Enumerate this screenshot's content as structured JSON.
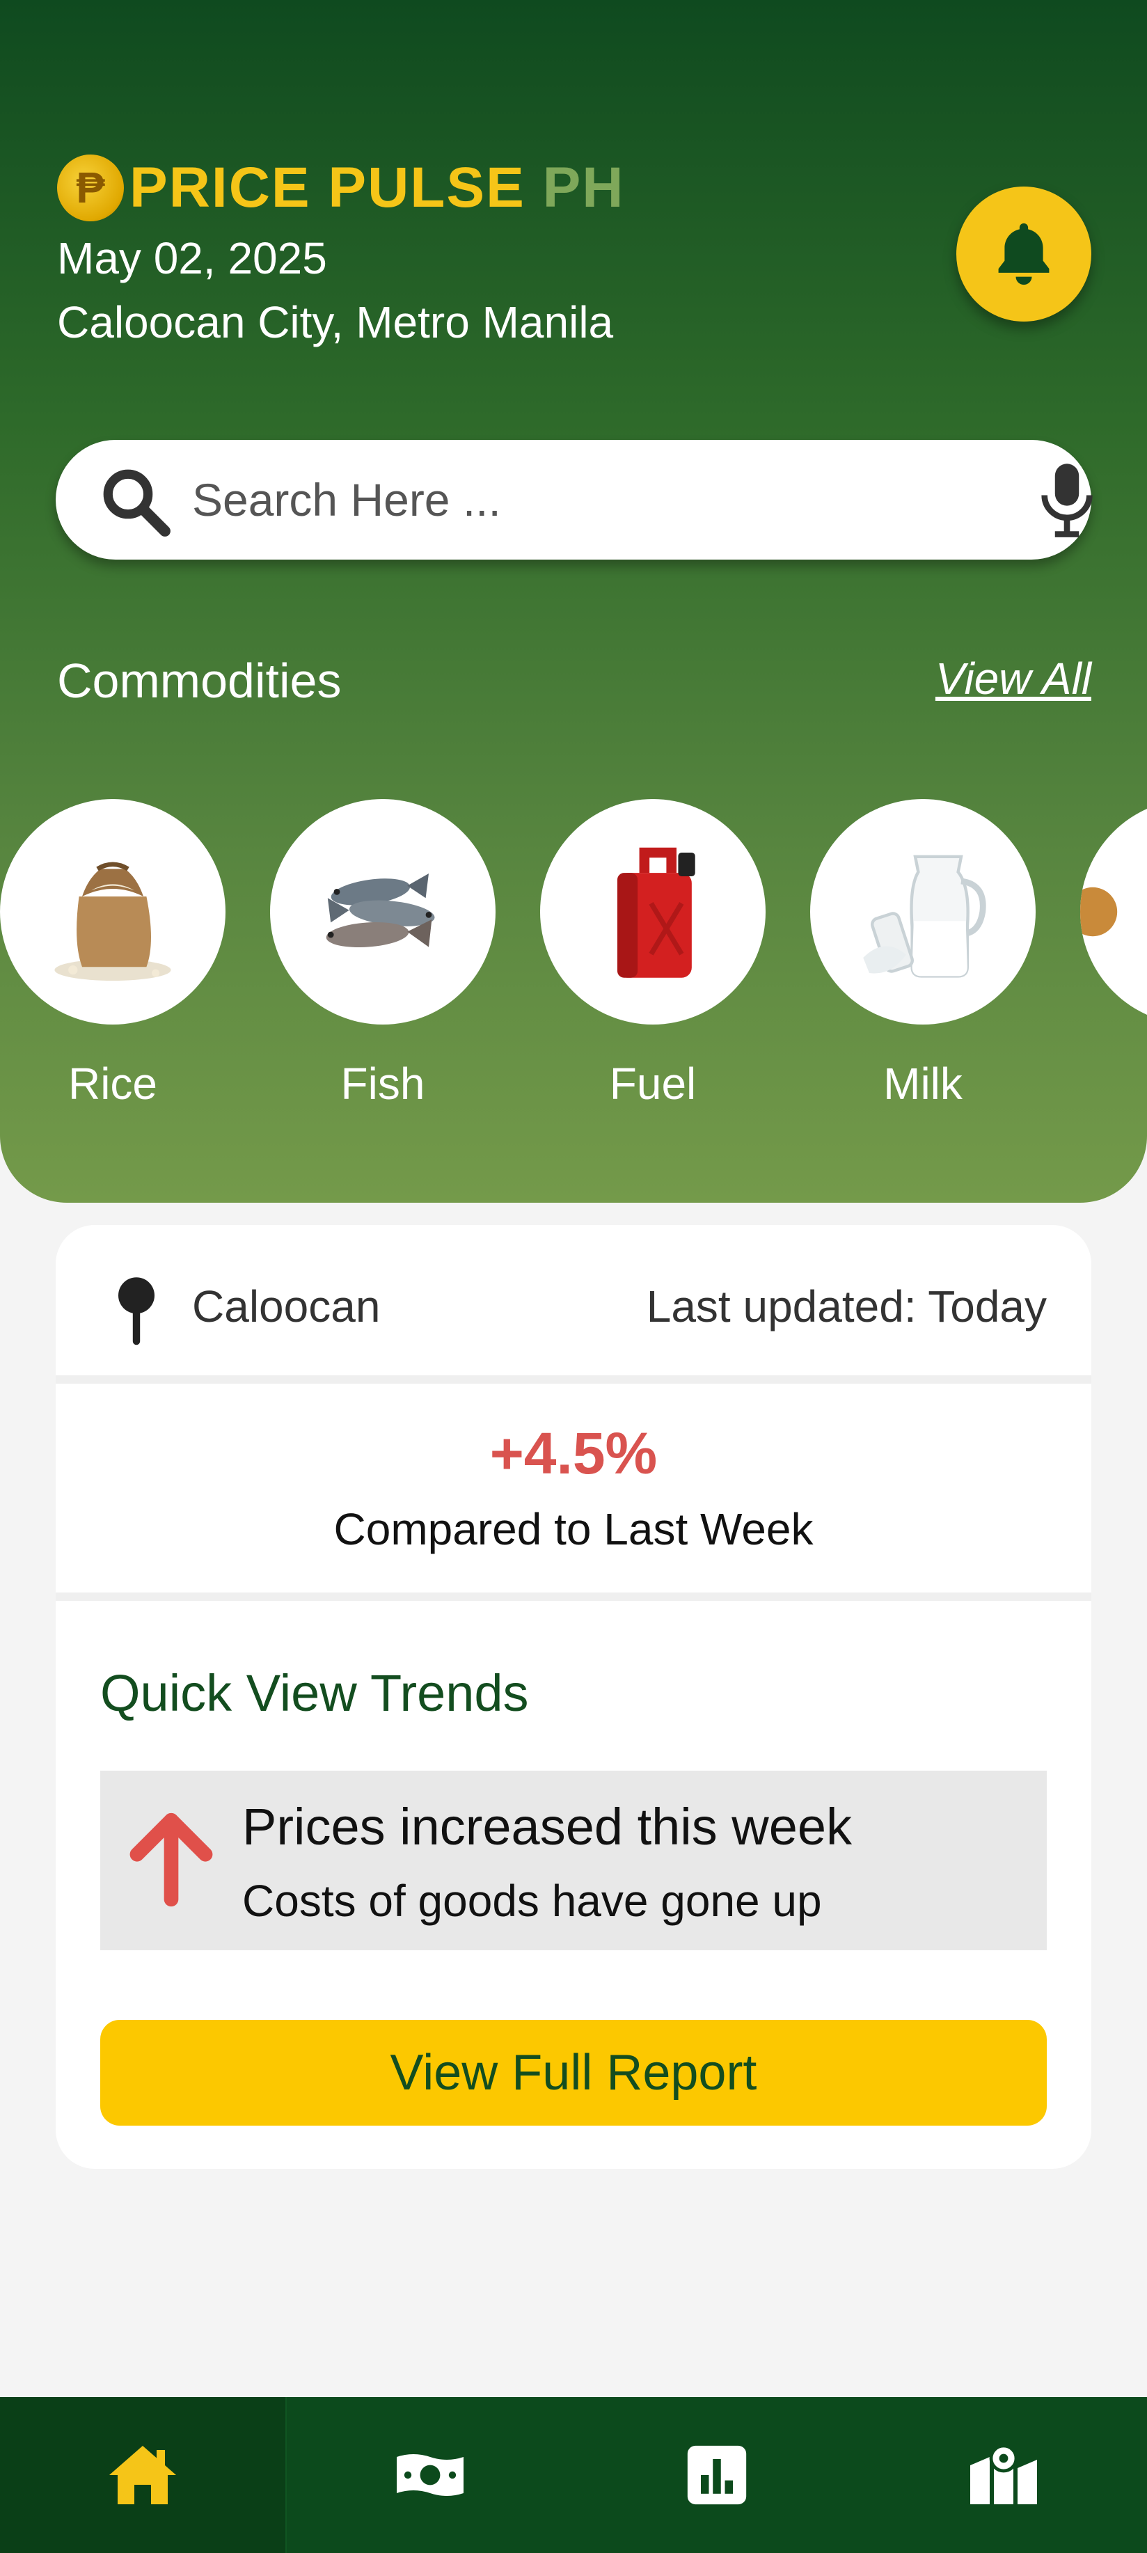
{
  "app": {
    "brand_main": "PRICE PULSE",
    "brand_suffix": "PH",
    "brand_logo_glyph": "₱"
  },
  "header": {
    "date": "May 02, 2025",
    "location": "Caloocan City, Metro Manila"
  },
  "search": {
    "placeholder": "Search Here ..."
  },
  "commodities": {
    "title": "Commodities",
    "view_all": "View All",
    "items": [
      {
        "label": "Rice",
        "icon": "rice-sack-icon"
      },
      {
        "label": "Fish",
        "icon": "fish-icon"
      },
      {
        "label": "Fuel",
        "icon": "fuel-can-icon"
      },
      {
        "label": "Milk",
        "icon": "milk-jug-icon"
      },
      {
        "label": "",
        "icon": "partial-item-icon"
      }
    ]
  },
  "summary": {
    "location": "Caloocan",
    "last_updated": "Last updated: Today",
    "change_pct": "+4.5%",
    "change_caption": "Compared to Last Week"
  },
  "trends": {
    "title": "Quick View Trends",
    "headline": "Prices increased this week",
    "subtext": "Costs of goods have gone up",
    "button": "View Full Report"
  },
  "nav": [
    {
      "icon": "home-icon",
      "active": true
    },
    {
      "icon": "money-icon",
      "active": false
    },
    {
      "icon": "bar-chart-icon",
      "active": false
    },
    {
      "icon": "map-icon",
      "active": false
    }
  ],
  "colors": {
    "brand_green": "#0f4a1f",
    "accent_yellow": "#f5c518",
    "increase_red": "#d9534f"
  }
}
